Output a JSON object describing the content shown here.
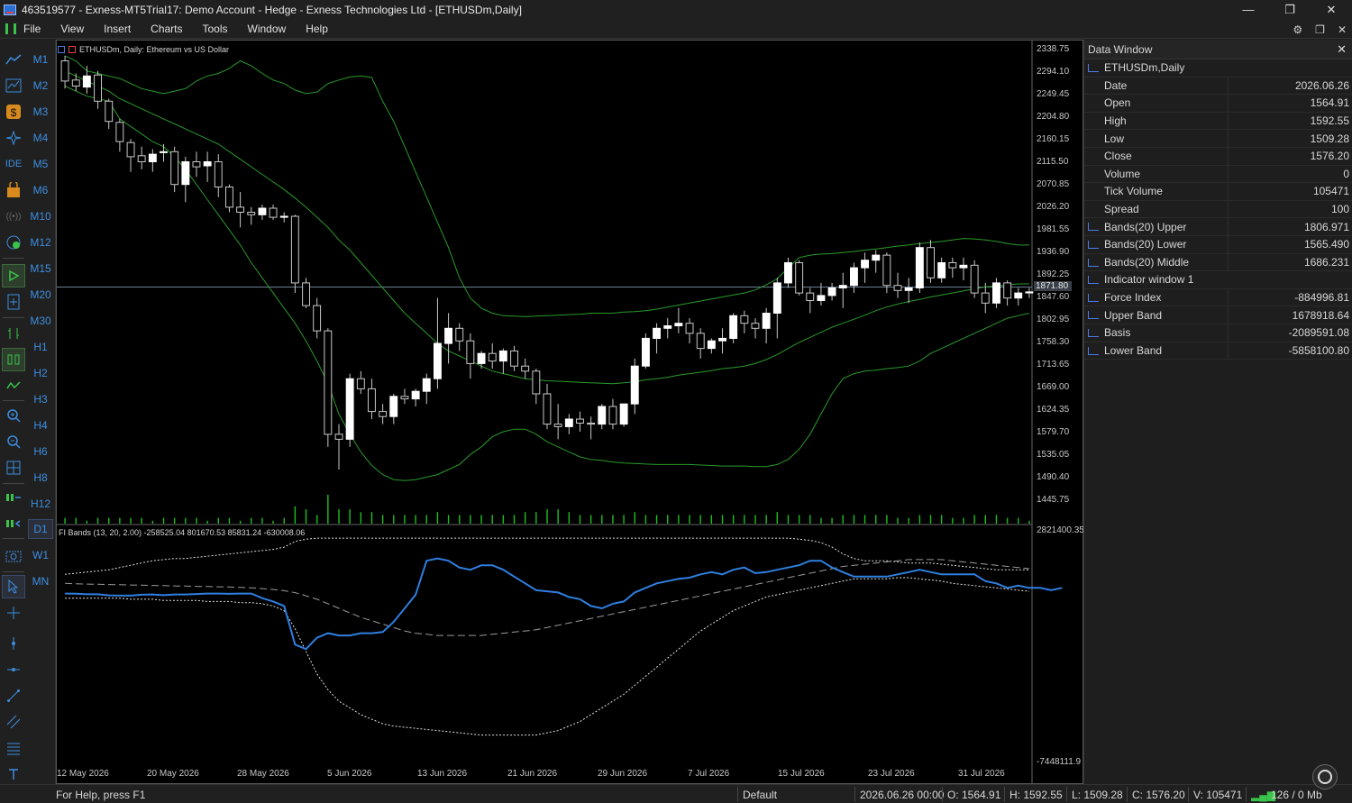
{
  "window": {
    "title": "463519577 - Exness-MT5Trial17: Demo Account - Hedge - Exness Technologies Ltd - [ETHUSDm,Daily]",
    "minimize": "—",
    "maximize": "❐",
    "close": "✕"
  },
  "menu": {
    "items": [
      "File",
      "View",
      "Insert",
      "Charts",
      "Tools",
      "Window",
      "Help"
    ],
    "right_icons": [
      "⚙",
      "❐",
      "✕"
    ]
  },
  "timeframes": [
    "M1",
    "M2",
    "M3",
    "M4",
    "M5",
    "M6",
    "M10",
    "M12",
    "M15",
    "M20",
    "M30",
    "H1",
    "H2",
    "H3",
    "H4",
    "H6",
    "H8",
    "H12",
    "D1",
    "W1",
    "MN"
  ],
  "active_timeframe": "D1",
  "chart": {
    "symbol_title": "ETHUSDm, Daily:  Ethereum vs US Dollar",
    "indicator_title": "FI Bands (13, 20, 2.00) -258525.04 801670.53 85831.24 -630008.06",
    "current_price_label": "1871.80",
    "price_axis": [
      "2338.75",
      "2294.10",
      "2249.45",
      "2204.80",
      "2160.15",
      "2115.50",
      "2070.85",
      "2026.20",
      "1981.55",
      "1936.90",
      "1892.25",
      "1847.60",
      "1802.95",
      "1758.30",
      "1713.65",
      "1669.00",
      "1624.35",
      "1579.70",
      "1535.05",
      "1490.40",
      "1445.75"
    ],
    "indicator_axis_top": "2821400.35",
    "indicator_axis_bottom": "-7448111.9",
    "date_axis": [
      "12 May 2026",
      "20 May 2026",
      "28 May 2026",
      "5 Jun 2026",
      "13 Jun 2026",
      "21 Jun 2026",
      "29 Jun 2026",
      "7 Jul 2026",
      "15 Jul 2026",
      "23 Jul 2026",
      "31 Jul 2026"
    ],
    "colors": {
      "bull": "#ffffff",
      "bear": "#000000",
      "wick": "#c8c8c8",
      "bands": "#2a9a2a",
      "volume": "#1fbf1f",
      "force": "#2f7fe0",
      "dotted": "#e0e0e0",
      "basis": "#9a9a9a"
    }
  },
  "chart_data": {
    "type": "candlestick",
    "candles": [
      [
        2320,
        2330,
        2265,
        2280
      ],
      [
        2282,
        2295,
        2260,
        2270
      ],
      [
        2268,
        2310,
        2255,
        2290
      ],
      [
        2292,
        2300,
        2225,
        2240
      ],
      [
        2240,
        2245,
        2185,
        2200
      ],
      [
        2198,
        2205,
        2140,
        2160
      ],
      [
        2158,
        2165,
        2100,
        2130
      ],
      [
        2132,
        2150,
        2105,
        2120
      ],
      [
        2120,
        2145,
        2100,
        2135
      ],
      [
        2138,
        2155,
        2120,
        2140
      ],
      [
        2140,
        2150,
        2060,
        2075
      ],
      [
        2075,
        2130,
        2040,
        2120
      ],
      [
        2120,
        2140,
        2090,
        2110
      ],
      [
        2112,
        2140,
        2080,
        2120
      ],
      [
        2120,
        2135,
        2050,
        2070
      ],
      [
        2070,
        2075,
        2020,
        2030
      ],
      [
        2030,
        2060,
        1990,
        2020
      ],
      [
        2020,
        2030,
        1995,
        2015
      ],
      [
        2015,
        2035,
        2005,
        2028
      ],
      [
        2028,
        2035,
        2005,
        2010
      ],
      [
        2010,
        2020,
        2000,
        2012
      ],
      [
        2012,
        2015,
        1860,
        1880
      ],
      [
        1880,
        1890,
        1830,
        1835
      ],
      [
        1835,
        1850,
        1770,
        1785
      ],
      [
        1785,
        1790,
        1555,
        1580
      ],
      [
        1580,
        1600,
        1510,
        1570
      ],
      [
        1570,
        1700,
        1555,
        1690
      ],
      [
        1690,
        1705,
        1660,
        1670
      ],
      [
        1670,
        1690,
        1610,
        1625
      ],
      [
        1625,
        1640,
        1600,
        1615
      ],
      [
        1615,
        1660,
        1600,
        1655
      ],
      [
        1655,
        1670,
        1640,
        1650
      ],
      [
        1650,
        1670,
        1635,
        1665
      ],
      [
        1665,
        1700,
        1640,
        1690
      ],
      [
        1690,
        1850,
        1670,
        1760
      ],
      [
        1760,
        1820,
        1720,
        1790
      ],
      [
        1790,
        1800,
        1745,
        1765
      ],
      [
        1765,
        1780,
        1690,
        1720
      ],
      [
        1720,
        1745,
        1710,
        1740
      ],
      [
        1740,
        1760,
        1710,
        1725
      ],
      [
        1725,
        1750,
        1700,
        1745
      ],
      [
        1745,
        1755,
        1705,
        1715
      ],
      [
        1715,
        1730,
        1690,
        1705
      ],
      [
        1705,
        1710,
        1640,
        1660
      ],
      [
        1660,
        1680,
        1590,
        1600
      ],
      [
        1600,
        1640,
        1570,
        1595
      ],
      [
        1595,
        1620,
        1580,
        1610
      ],
      [
        1610,
        1625,
        1585,
        1602
      ],
      [
        1602,
        1615,
        1570,
        1600
      ],
      [
        1600,
        1640,
        1590,
        1635
      ],
      [
        1635,
        1650,
        1590,
        1600
      ],
      [
        1600,
        1640,
        1595,
        1640
      ],
      [
        1640,
        1730,
        1620,
        1715
      ],
      [
        1715,
        1780,
        1710,
        1770
      ],
      [
        1770,
        1800,
        1740,
        1790
      ],
      [
        1790,
        1810,
        1770,
        1795
      ],
      [
        1795,
        1830,
        1780,
        1800
      ],
      [
        1800,
        1810,
        1760,
        1780
      ],
      [
        1780,
        1790,
        1730,
        1750
      ],
      [
        1750,
        1770,
        1740,
        1765
      ],
      [
        1765,
        1790,
        1740,
        1770
      ],
      [
        1770,
        1820,
        1760,
        1815
      ],
      [
        1815,
        1825,
        1780,
        1800
      ],
      [
        1800,
        1810,
        1770,
        1790
      ],
      [
        1790,
        1830,
        1760,
        1820
      ],
      [
        1820,
        1890,
        1770,
        1880
      ],
      [
        1880,
        1930,
        1870,
        1920
      ],
      [
        1920,
        1925,
        1855,
        1860
      ],
      [
        1860,
        1870,
        1820,
        1845
      ],
      [
        1845,
        1880,
        1835,
        1855
      ],
      [
        1855,
        1880,
        1845,
        1870
      ],
      [
        1870,
        1900,
        1830,
        1875
      ],
      [
        1875,
        1920,
        1860,
        1910
      ],
      [
        1910,
        1940,
        1880,
        1925
      ],
      [
        1925,
        1945,
        1900,
        1935
      ],
      [
        1935,
        1940,
        1860,
        1875
      ],
      [
        1875,
        1900,
        1850,
        1865
      ],
      [
        1865,
        1890,
        1840,
        1870
      ],
      [
        1870,
        1960,
        1860,
        1950
      ],
      [
        1950,
        1965,
        1880,
        1890
      ],
      [
        1890,
        1930,
        1880,
        1920
      ],
      [
        1920,
        1930,
        1890,
        1910
      ],
      [
        1910,
        1930,
        1885,
        1915
      ],
      [
        1915,
        1925,
        1850,
        1860
      ],
      [
        1860,
        1880,
        1820,
        1840
      ],
      [
        1840,
        1890,
        1830,
        1880
      ],
      [
        1880,
        1885,
        1835,
        1850
      ],
      [
        1850,
        1870,
        1835,
        1860
      ],
      [
        1860,
        1870,
        1850,
        1862
      ]
    ],
    "volume": [
      0.2,
      0.2,
      0.1,
      0.2,
      0.2,
      0.2,
      0.2,
      0.2,
      0.1,
      0.2,
      0.2,
      0.2,
      0.2,
      0.1,
      0.2,
      0.2,
      0.1,
      0.2,
      0.2,
      0.1,
      0.2,
      0.6,
      0.5,
      0.3,
      1.0,
      0.5,
      0.5,
      0.4,
      0.4,
      0.3,
      0.3,
      0.3,
      0.3,
      0.3,
      0.4,
      0.3,
      0.3,
      0.3,
      0.3,
      0.3,
      0.3,
      0.3,
      0.4,
      0.4,
      0.5,
      0.5,
      0.4,
      0.3,
      0.3,
      0.3,
      0.3,
      0.3,
      0.4,
      0.3,
      0.3,
      0.3,
      0.3,
      0.3,
      0.3,
      0.3,
      0.3,
      0.3,
      0.3,
      0.3,
      0.3,
      0.4,
      0.3,
      0.3,
      0.3,
      0.2,
      0.2,
      0.3,
      0.3,
      0.3,
      0.3,
      0.3,
      0.2,
      0.2,
      0.3,
      0.3,
      0.3,
      0.2,
      0.2,
      0.3,
      0.3,
      0.3,
      0.2,
      0.2,
      0.1
    ],
    "bands_upper": [
      2330,
      2320,
      2300,
      2295,
      2290,
      2285,
      2275,
      2265,
      2260,
      2255,
      2260,
      2265,
      2280,
      2290,
      2295,
      2305,
      2320,
      2310,
      2295,
      2282,
      2275,
      2262,
      2255,
      2258,
      2275,
      2282,
      2288,
      2290,
      2287,
      2240,
      2200,
      2150,
      2100,
      2050,
      2000,
      1950,
      1890,
      1850,
      1830,
      1820,
      1815,
      1814,
      1813,
      1814,
      1815,
      1816,
      1817,
      1818,
      1820,
      1820,
      1820,
      1822,
      1823,
      1825,
      1828,
      1832,
      1836,
      1840,
      1844,
      1848,
      1852,
      1856,
      1860,
      1866,
      1876,
      1888,
      1910,
      1930,
      1935,
      1937,
      1938,
      1940,
      1942,
      1945,
      1947,
      1950,
      1953,
      1955,
      1958,
      1960,
      1962,
      1965,
      1968,
      1967,
      1965,
      1962,
      1958,
      1955,
      1955
    ],
    "bands_middle": [
      2300,
      2290,
      2280,
      2270,
      2260,
      2245,
      2235,
      2225,
      2215,
      2205,
      2195,
      2185,
      2175,
      2165,
      2155,
      2140,
      2125,
      2110,
      2095,
      2080,
      2065,
      2048,
      2030,
      2010,
      1990,
      1965,
      1945,
      1920,
      1895,
      1870,
      1845,
      1820,
      1800,
      1780,
      1760,
      1745,
      1735,
      1725,
      1715,
      1705,
      1700,
      1695,
      1690,
      1688,
      1686,
      1685,
      1684,
      1683,
      1682,
      1681,
      1680,
      1682,
      1684,
      1688,
      1690,
      1693,
      1697,
      1700,
      1703,
      1706,
      1710,
      1712,
      1715,
      1720,
      1728,
      1738,
      1750,
      1762,
      1772,
      1782,
      1792,
      1800,
      1808,
      1816,
      1825,
      1832,
      1838,
      1843,
      1847,
      1852,
      1856,
      1860,
      1864,
      1868,
      1872,
      1874,
      1876,
      1878,
      1878
    ],
    "bands_lower": [
      2270,
      2260,
      2250,
      2245,
      2240,
      2205,
      2190,
      2175,
      2160,
      2150,
      2130,
      2105,
      2075,
      2045,
      2015,
      1985,
      1955,
      1920,
      1890,
      1860,
      1830,
      1800,
      1765,
      1725,
      1680,
      1620,
      1580,
      1545,
      1518,
      1500,
      1490,
      1488,
      1490,
      1495,
      1500,
      1510,
      1520,
      1540,
      1555,
      1575,
      1585,
      1590,
      1590,
      1580,
      1565,
      1555,
      1545,
      1535,
      1530,
      1528,
      1525,
      1523,
      1522,
      1521,
      1520,
      1520,
      1520,
      1520,
      1519,
      1518,
      1517,
      1517,
      1517,
      1516,
      1516,
      1520,
      1530,
      1550,
      1580,
      1620,
      1660,
      1690,
      1700,
      1705,
      1707,
      1710,
      1712,
      1715,
      1725,
      1740,
      1750,
      1760,
      1770,
      1780,
      1790,
      1800,
      1810,
      1815,
      1820
    ],
    "force_index": [
      50,
      45,
      20,
      20,
      -30,
      -40,
      -40,
      0,
      10,
      -20,
      10,
      10,
      30,
      50,
      50,
      40,
      50,
      50,
      -150,
      -300,
      -500,
      -2200,
      -2400,
      -1900,
      -1700,
      -1800,
      -1800,
      -1700,
      -1700,
      -1650,
      -1200,
      -600,
      0,
      1500,
      1600,
      1500,
      1200,
      1100,
      1300,
      1300,
      1100,
      800,
      500,
      200,
      150,
      100,
      -100,
      -200,
      -500,
      -600,
      -400,
      -300,
      100,
      300,
      500,
      600,
      700,
      750,
      900,
      1000,
      900,
      1100,
      1200,
      950,
      1000,
      1100,
      1200,
      1300,
      1500,
      1500,
      1200,
      1000,
      800,
      800,
      800,
      800,
      900,
      1000,
      1100,
      1000,
      900,
      900,
      900,
      900,
      600,
      500,
      300,
      400,
      300,
      300,
      200,
      300
    ],
    "fi_upper": [
      900,
      950,
      1000,
      1050,
      1100,
      1200,
      1300,
      1400,
      1500,
      1550,
      1600,
      1600,
      1650,
      1700,
      1750,
      1800,
      1850,
      1900,
      1950,
      2000,
      2100,
      2350,
      2450,
      2500,
      2500,
      2500,
      2500,
      2500,
      2500,
      2500,
      2500,
      2500,
      2500,
      2500,
      2500,
      2500,
      2500,
      2500,
      2500,
      2500,
      2500,
      2500,
      2500,
      2500,
      2500,
      2500,
      2500,
      2500,
      2500,
      2500,
      2500,
      2500,
      2500,
      2500,
      2500,
      2500,
      2500,
      2500,
      2500,
      2500,
      2500,
      2500,
      2500,
      2500,
      2500,
      2500,
      2500,
      2450,
      2400,
      2300,
      2100,
      1800,
      1600,
      1500,
      1500,
      1500,
      1450,
      1400,
      1400,
      1400,
      1350,
      1300,
      1250,
      1200,
      1150,
      1100,
      1100,
      1100,
      1100
    ],
    "fi_basis": [
      500,
      480,
      470,
      460,
      450,
      440,
      430,
      420,
      410,
      400,
      390,
      380,
      370,
      360,
      350,
      340,
      320,
      300,
      270,
      230,
      180,
      90,
      -50,
      -200,
      -400,
      -600,
      -800,
      -1000,
      -1150,
      -1300,
      -1450,
      -1600,
      -1700,
      -1750,
      -1800,
      -1800,
      -1800,
      -1800,
      -1800,
      -1750,
      -1700,
      -1650,
      -1600,
      -1550,
      -1450,
      -1350,
      -1250,
      -1150,
      -1050,
      -950,
      -850,
      -750,
      -650,
      -550,
      -450,
      -350,
      -250,
      -150,
      -50,
      50,
      150,
      250,
      350,
      450,
      550,
      650,
      750,
      850,
      950,
      1050,
      1150,
      1250,
      1300,
      1350,
      1400,
      1450,
      1500,
      1550,
      1550,
      1550,
      1550,
      1500,
      1450,
      1400,
      1350,
      1300,
      1250,
      1200,
      1150
    ],
    "fi_lower": [
      -150,
      -150,
      -150,
      -150,
      -150,
      -150,
      -200,
      -200,
      -200,
      -250,
      -250,
      -250,
      -250,
      -300,
      -300,
      -300,
      -350,
      -350,
      -400,
      -500,
      -700,
      -1500,
      -2500,
      -3500,
      -4200,
      -4700,
      -5000,
      -5300,
      -5500,
      -5700,
      -5800,
      -5850,
      -5900,
      -5950,
      -6000,
      -6050,
      -6100,
      -6150,
      -6200,
      -6200,
      -6200,
      -6200,
      -6200,
      -6200,
      -6100,
      -6000,
      -5800,
      -5600,
      -5300,
      -5000,
      -4700,
      -4400,
      -4000,
      -3600,
      -3200,
      -2800,
      -2400,
      -2000,
      -1600,
      -1300,
      -1000,
      -700,
      -500,
      -300,
      -100,
      0,
      100,
      200,
      300,
      400,
      500,
      600,
      700,
      700,
      700,
      700,
      750,
      750,
      700,
      650,
      600,
      500,
      450,
      400,
      350,
      300,
      250,
      200,
      150
    ]
  },
  "data_window": {
    "title": "Data Window",
    "symbol_row": "ETHUSDm,Daily",
    "rows": [
      {
        "label": "Date",
        "value": "2026.06.26"
      },
      {
        "label": "Open",
        "value": "1564.91"
      },
      {
        "label": "High",
        "value": "1592.55"
      },
      {
        "label": "Low",
        "value": "1509.28"
      },
      {
        "label": "Close",
        "value": "1576.20"
      },
      {
        "label": "Volume",
        "value": "0"
      },
      {
        "label": "Tick Volume",
        "value": "105471"
      },
      {
        "label": "Spread",
        "value": "100"
      }
    ],
    "bands_rows": [
      {
        "label": "Bands(20) Upper",
        "value": "1806.971"
      },
      {
        "label": "Bands(20) Lower",
        "value": "1565.490"
      },
      {
        "label": "Bands(20) Middle",
        "value": "1686.231"
      }
    ],
    "indicator_section": "Indicator window 1",
    "indicator_rows": [
      {
        "label": "Force Index",
        "value": "-884996.81"
      },
      {
        "label": "Upper Band",
        "value": "1678918.64"
      },
      {
        "label": "Basis",
        "value": "-2089591.08"
      },
      {
        "label": "Lower Band",
        "value": "-5858100.80"
      }
    ]
  },
  "status": {
    "help": "For Help, press F1",
    "profile": "Default",
    "datetime": "2026.06.26 00:00",
    "open": "O: 1564.91",
    "high": "H: 1592.55",
    "low": "L: 1509.28",
    "close": "C: 1576.20",
    "volume": "V: 105471",
    "traffic": "126 / 0 Mb"
  }
}
